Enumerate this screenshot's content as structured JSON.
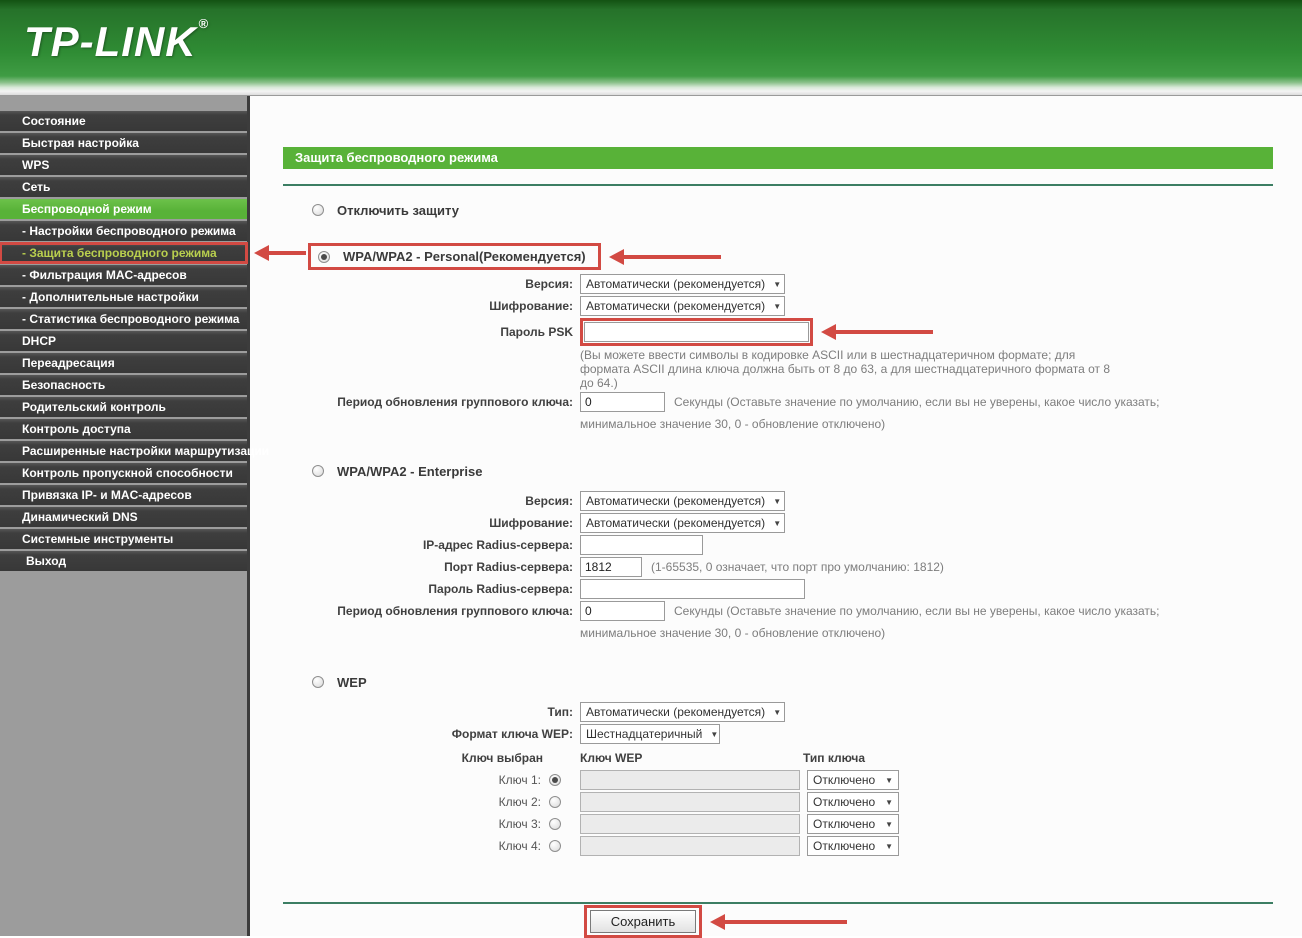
{
  "brand": {
    "logo_text": "TP-LINK",
    "registered_mark": "®"
  },
  "colors": {
    "accent-green": "#58b238",
    "sidebar-gray": "#9c9c9c",
    "menu-dark": "#3f3f3f",
    "annotation-red": "#d24a43",
    "current-yellow": "#b9cf4e",
    "separator-teal": "#3c7e63",
    "hint-gray": "#7d7d7d",
    "label-dark": "#404040"
  },
  "sidebar": {
    "items": [
      {
        "name": "status",
        "label": "Состояние",
        "type": "top"
      },
      {
        "name": "quick-setup",
        "label": "Быстрая настройка",
        "type": "top"
      },
      {
        "name": "wps",
        "label": "WPS",
        "type": "top"
      },
      {
        "name": "network",
        "label": "Сеть",
        "type": "top"
      },
      {
        "name": "wireless",
        "label": "Беспроводной режим",
        "type": "top",
        "active": true
      },
      {
        "name": "wireless-settings",
        "label": "- Настройки беспроводного режима",
        "type": "sub"
      },
      {
        "name": "wireless-security",
        "label": "- Защита беспроводного режима",
        "type": "sub",
        "annotated": true
      },
      {
        "name": "mac-filtering",
        "label": "- Фильтрация MAC-адресов",
        "type": "sub"
      },
      {
        "name": "advanced-wireless",
        "label": "- Дополнительные настройки",
        "type": "sub"
      },
      {
        "name": "wireless-statistics",
        "label": "- Статистика беспроводного режима",
        "type": "sub"
      },
      {
        "name": "dhcp",
        "label": "DHCP",
        "type": "top"
      },
      {
        "name": "forwarding",
        "label": "Переадресация",
        "type": "top"
      },
      {
        "name": "security",
        "label": "Безопасность",
        "type": "top"
      },
      {
        "name": "parental-control",
        "label": "Родительский контроль",
        "type": "top"
      },
      {
        "name": "access-control",
        "label": "Контроль доступа",
        "type": "top"
      },
      {
        "name": "advanced-routing",
        "label": "Расширенные настройки маршрутизации",
        "type": "top"
      },
      {
        "name": "bandwidth-control",
        "label": "Контроль пропускной способности",
        "type": "top"
      },
      {
        "name": "ip-mac-binding",
        "label": "Привязка IP- и MAC-адресов",
        "type": "top"
      },
      {
        "name": "dynamic-dns",
        "label": "Динамический DNS",
        "type": "top"
      },
      {
        "name": "system-tools",
        "label": "Системные инструменты",
        "type": "top"
      },
      {
        "name": "logout",
        "label": "Выход",
        "type": "exit"
      }
    ]
  },
  "main": {
    "title": "Защита беспроводного режима",
    "save_label": "Сохранить",
    "disable_option": {
      "label": "Отключить защиту",
      "selected": false
    }
  },
  "wpa_personal": {
    "heading": "WPA/WPA2 - Personal(Рекомендуется)",
    "selected": true,
    "version_label": "Версия:",
    "version_value": "Автоматически (рекомендуется)",
    "encryption_label": "Шифрование:",
    "encryption_value": "Автоматически (рекомендуется)",
    "psk_label": "Пароль PSK",
    "psk_value": "",
    "psk_hint": "(Вы можете ввести символы в кодировке ASCII или в шестнадцатеричном формате; для формата ASCII длина ключа должна быть от 8 до 63, а для шестнадцатеричного формата от 8 до 64.)",
    "group_key_label": "Период обновления группового ключа:",
    "group_key_value": "0",
    "group_key_hint_inline": "Секунды (Оставьте значение по умолчанию, если вы не уверены, какое число указать;",
    "group_key_hint_below": "минимальное значение 30, 0 - обновление отключено)"
  },
  "wpa_enterprise": {
    "heading": "WPA/WPA2 - Enterprise",
    "selected": false,
    "version_label": "Версия:",
    "version_value": "Автоматически (рекомендуется)",
    "encryption_label": "Шифрование:",
    "encryption_value": "Автоматически (рекомендуется)",
    "radius_ip_label": "IP-адрес Radius-сервера:",
    "radius_ip_value": "",
    "radius_port_label": "Порт Radius-сервера:",
    "radius_port_value": "1812",
    "radius_port_hint": "(1-65535, 0 означает, что порт про умолчанию: 1812)",
    "radius_password_label": "Пароль Radius-сервера:",
    "radius_password_value": "",
    "group_key_label": "Период обновления группового ключа:",
    "group_key_value": "0",
    "group_key_hint_inline": "Секунды (Оставьте значение по умолчанию, если вы не уверены, какое число указать;",
    "group_key_hint_below": "минимальное значение 30, 0 - обновление отключено)"
  },
  "wep": {
    "heading": "WEP",
    "selected": false,
    "type_label": "Тип:",
    "type_value": "Автоматически (рекомендуется)",
    "format_label": "Формат ключа WEP:",
    "format_value": "Шестнадцатеричный",
    "col_selected": "Ключ выбран",
    "col_key": "Ключ WEP",
    "col_type": "Тип ключа",
    "keys": [
      {
        "label": "Ключ 1:",
        "selected": true,
        "value": "",
        "type_value": "Отключено"
      },
      {
        "label": "Ключ 2:",
        "selected": false,
        "value": "",
        "type_value": "Отключено"
      },
      {
        "label": "Ключ 3:",
        "selected": false,
        "value": "",
        "type_value": "Отключено"
      },
      {
        "label": "Ключ 4:",
        "selected": false,
        "value": "",
        "type_value": "Отключено"
      }
    ]
  }
}
